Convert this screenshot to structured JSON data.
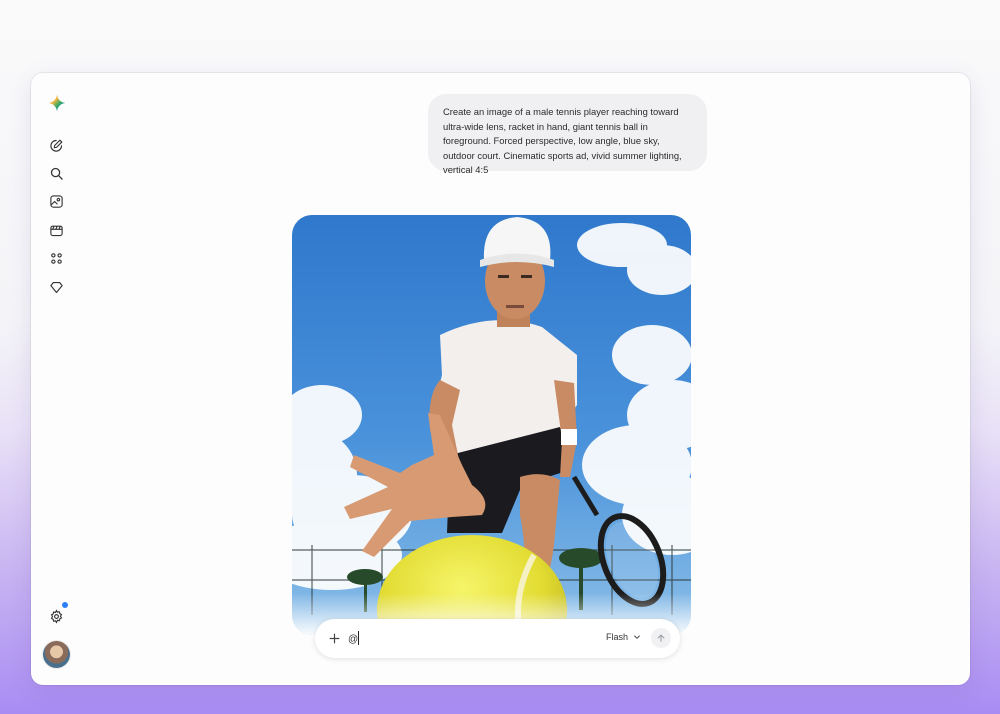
{
  "sidebar": {
    "logo_icon": "gemini-sparkle-icon",
    "items": [
      {
        "icon": "new-chat-pencil-icon"
      },
      {
        "icon": "search-icon"
      },
      {
        "icon": "image-gallery-icon"
      },
      {
        "icon": "video-clapper-icon"
      },
      {
        "icon": "apps-grid-icon"
      },
      {
        "icon": "gem-icon"
      }
    ],
    "settings_icon": "gear-icon",
    "settings_badge_color": "#2d7ff9",
    "avatar_icon": "user-avatar"
  },
  "chat": {
    "prompt": "Create an image of a male tennis player reaching toward ultra-wide lens, racket in hand, giant tennis ball in foreground. Forced perspective, low angle, blue sky, outdoor court. Cinematic sports ad, vivid summer lighting, vertical 4:5",
    "generated_image": "tennis-player-low-angle-image"
  },
  "composer": {
    "value": "@",
    "placeholder": "",
    "model": "Flash",
    "send_icon": "arrow-up-icon",
    "add_icon": "plus-icon"
  },
  "colors": {
    "accent": "#2d7ff9",
    "bubble": "#f0f0f2",
    "sky": "#3c86d4",
    "ball": "#e6e23a"
  }
}
